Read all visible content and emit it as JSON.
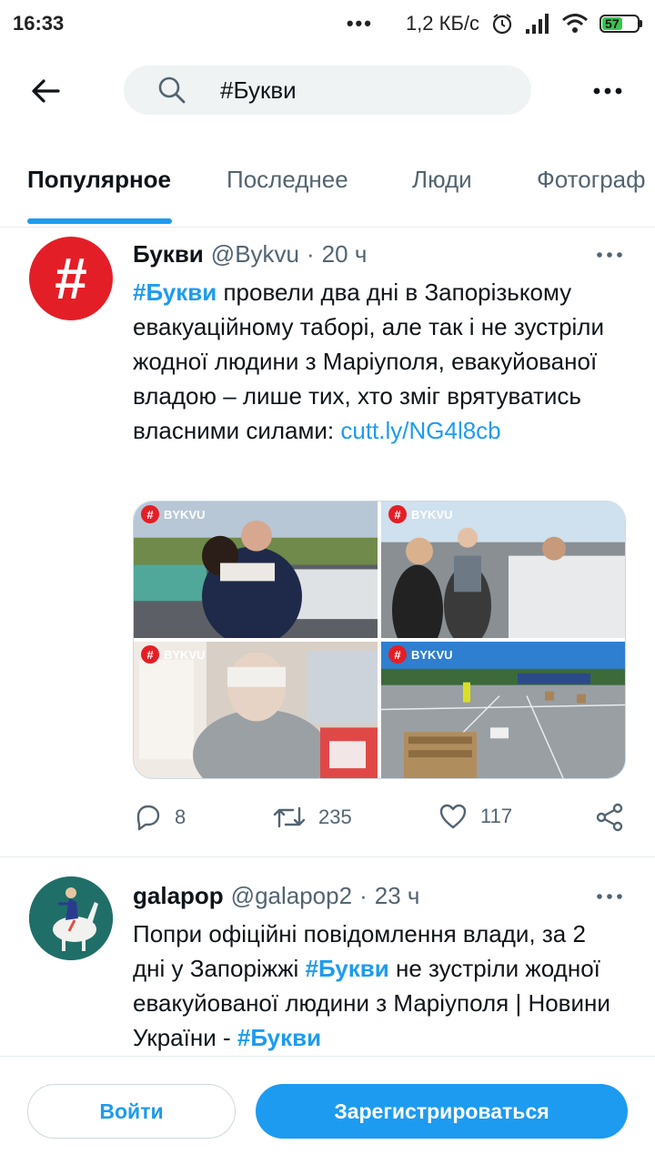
{
  "status_bar": {
    "time": "16:33",
    "more": "•••",
    "speed": "1,2 КБ/с",
    "battery": "57",
    "battery_level": 0.57,
    "icons": [
      "alarm-icon",
      "signal-icon",
      "wifi-icon",
      "battery-icon"
    ]
  },
  "search": {
    "query": "#Букви",
    "icons": [
      "back-arrow-icon",
      "search-icon",
      "more-icon"
    ]
  },
  "tabs": [
    {
      "label": "Популярное",
      "active": true
    },
    {
      "label": "Последнее",
      "active": false
    },
    {
      "label": "Люди",
      "active": false
    },
    {
      "label": "Фотограф",
      "active": false
    }
  ],
  "tweets": [
    {
      "name": "Букви",
      "handle": "@Bykvu",
      "sep": "·",
      "time": "20 ч",
      "avatar_glyph": "#",
      "text": {
        "hashtag": "#Букви",
        "body": " провели два дні в Запорізькому евакуаційному таборі, але так і не зустріли жодної людини з Маріуполя, евакуйованої владою – лише тих, хто зміг врятуватись власними силами: ",
        "link": "cutt.ly/NG4l8cb"
      },
      "media_badge": "BYKVU",
      "replies": "8",
      "retweets": "235",
      "likes": "117"
    },
    {
      "name": "galapop",
      "handle": "@galapop2",
      "sep": "·",
      "time": "23 ч",
      "text": {
        "part1": "Попри офіційні повідомлення влади, за 2 дні у Запоріжжі ",
        "hashtag1": "#Букви",
        "part2": " не зустріли жодної евакуйованої людини з Маріуполя | Новини України - ",
        "hashtag2": "#Букви"
      }
    }
  ],
  "bottom": {
    "login": "Войти",
    "signup": "Зарегистрироваться"
  },
  "colors": {
    "accent": "#1d9bf0",
    "brand_red": "#e41e26",
    "text": "#0f1419",
    "muted": "#536471"
  }
}
